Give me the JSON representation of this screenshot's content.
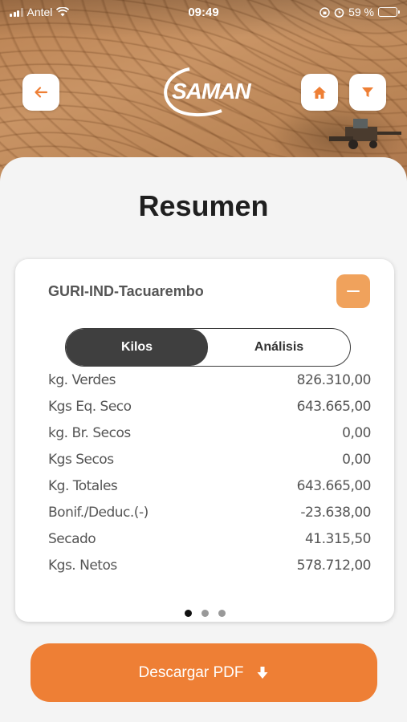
{
  "status_bar": {
    "carrier": "Antel",
    "time": "09:49",
    "battery": "59 %",
    "battery_level": 0.59
  },
  "header": {
    "logo_text": "SAMAN",
    "back_icon": "arrow-left-icon",
    "home_icon": "home-icon",
    "filter_icon": "filter-icon"
  },
  "page": {
    "title": "Resumen"
  },
  "card": {
    "title": "GURI-IND-Tacuarembo",
    "collapse_icon": "minus-icon",
    "tabs": [
      {
        "label": "Kilos",
        "active": true
      },
      {
        "label": "Análisis",
        "active": false
      }
    ],
    "rows": [
      {
        "label": "kg. Verdes",
        "value": "826.310,00"
      },
      {
        "label": "Kgs Eq. Seco",
        "value": "643.665,00"
      },
      {
        "label": "kg. Br. Secos",
        "value": "0,00"
      },
      {
        "label": "Kgs Secos",
        "value": "0,00"
      },
      {
        "label": "Kg. Totales",
        "value": "643.665,00"
      },
      {
        "label": "Bonif./Deduc.(-)",
        "value": "-23.638,00"
      },
      {
        "label": "Secado",
        "value": "41.315,50"
      },
      {
        "label": "Kgs. Netos",
        "value": "578.712,00"
      }
    ],
    "pager": {
      "count": 3,
      "active": 0
    }
  },
  "actions": {
    "download_label": "Descargar PDF",
    "download_icon": "arrow-down-icon"
  },
  "colors": {
    "accent": "#ee7f35",
    "accent_light": "#f0a25c",
    "segment_active": "#3f3f3f"
  }
}
